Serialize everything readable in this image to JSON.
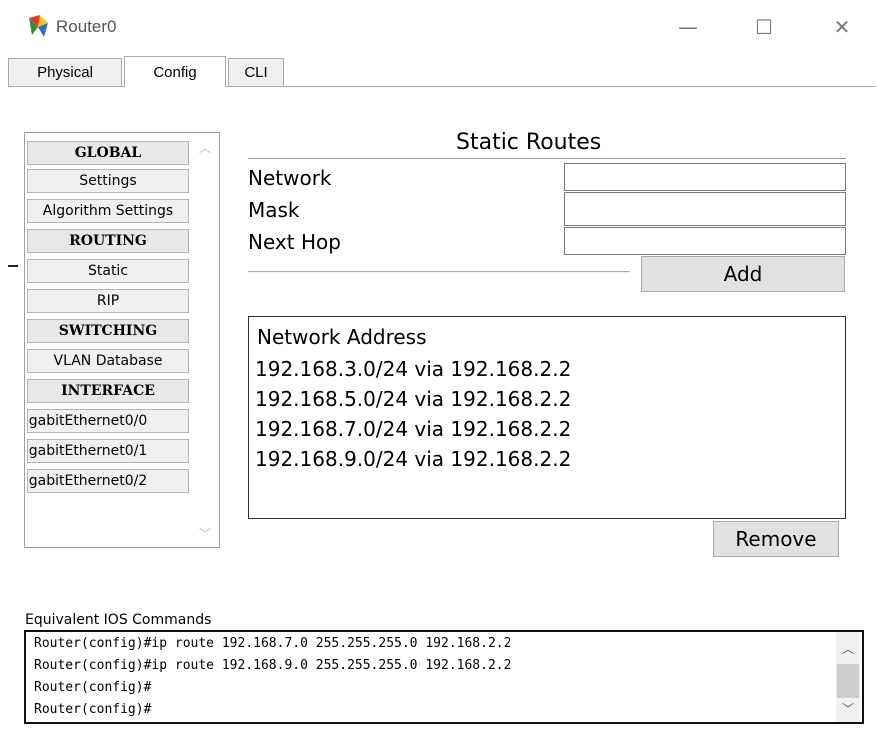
{
  "window": {
    "title": "Router0",
    "icon": "router-app-icon",
    "controls": {
      "minimize": "—",
      "maximize": "☐",
      "close": "✕"
    }
  },
  "tabs": [
    {
      "label": "Physical",
      "active": false
    },
    {
      "label": "Config",
      "active": true
    },
    {
      "label": "CLI",
      "active": false
    }
  ],
  "sidebar": {
    "items": [
      {
        "label": "GLOBAL",
        "type": "header"
      },
      {
        "label": "Settings",
        "type": "item"
      },
      {
        "label": "Algorithm Settings",
        "type": "item"
      },
      {
        "label": "ROUTING",
        "type": "header"
      },
      {
        "label": "Static",
        "type": "item"
      },
      {
        "label": "RIP",
        "type": "item"
      },
      {
        "label": "SWITCHING",
        "type": "header"
      },
      {
        "label": "VLAN Database",
        "type": "item"
      },
      {
        "label": "INTERFACE",
        "type": "header"
      },
      {
        "label": "GigabitEthernet0/0",
        "type": "item"
      },
      {
        "label": "GigabitEthernet0/1",
        "type": "item"
      },
      {
        "label": "GigabitEthernet0/2",
        "type": "item"
      }
    ]
  },
  "static_routes": {
    "heading": "Static Routes",
    "fields": {
      "network_label": "Network",
      "network_value": "",
      "mask_label": "Mask",
      "mask_value": "",
      "next_hop_label": "Next Hop",
      "next_hop_value": ""
    },
    "add_label": "Add",
    "list_header": "Network Address",
    "routes": [
      "192.168.3.0/24 via 192.168.2.2",
      "192.168.5.0/24 via 192.168.2.2",
      "192.168.7.0/24 via 192.168.2.2",
      "192.168.9.0/24 via 192.168.2.2"
    ],
    "remove_label": "Remove"
  },
  "ios": {
    "label": "Equivalent IOS Commands",
    "lines": [
      "Router(config)#ip route 192.168.7.0 255.255.255.0 192.168.2.2",
      "Router(config)#ip route 192.168.9.0 255.255.255.0 192.168.2.2",
      "Router(config)#",
      "Router(config)#"
    ]
  }
}
